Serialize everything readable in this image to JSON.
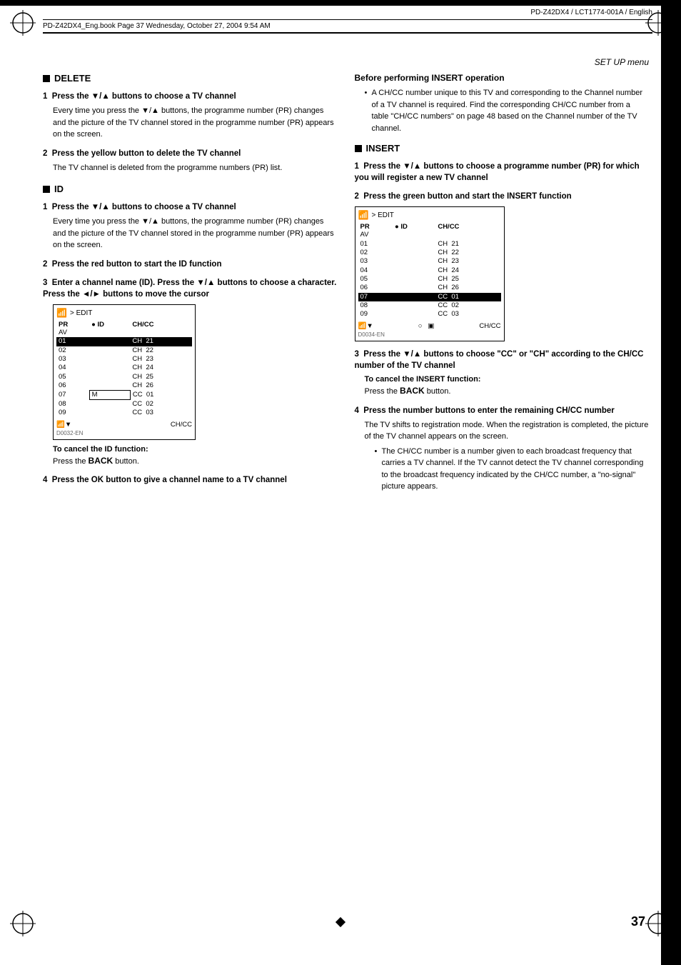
{
  "meta": {
    "product": "PD-Z42DX4 / LCT1774-001A / English",
    "book_line": "PD-Z42DX4_Eng.book  Page 37  Wednesday, October 27, 2004  9:54 AM",
    "page_title": "SET UP menu",
    "page_number": "37",
    "english_label": "ENGLISH"
  },
  "sections": {
    "delete": {
      "heading": "DELETE",
      "steps": [
        {
          "num": "1",
          "title": "Press the ▼/▲ buttons to choose a TV channel",
          "body": "Every time you press the ▼/▲ buttons, the programme number (PR) changes and the picture of the TV channel stored in the programme number (PR) appears on the screen."
        },
        {
          "num": "2",
          "title": "Press the yellow button to delete the TV channel",
          "body": "The TV channel is deleted from the programme numbers (PR) list."
        }
      ]
    },
    "id": {
      "heading": "ID",
      "steps": [
        {
          "num": "1",
          "title": "Press the ▼/▲ buttons to choose a TV channel",
          "body": "Every time you press the ▼/▲ buttons, the programme number (PR) changes and the picture of the TV channel stored in the programme number (PR) appears on the screen."
        },
        {
          "num": "2",
          "title": "Press the red button to start the ID function",
          "body": ""
        },
        {
          "num": "3",
          "title": "Enter a channel name (ID). Press the ▼/▲ buttons to choose a character. Press the ◄/► buttons to move the cursor",
          "body": ""
        }
      ],
      "cancel_note": "To cancel the ID function:",
      "cancel_body": "Press the BACK button.",
      "step4": {
        "num": "4",
        "title": "Press the OK button to give a channel name to a TV channel",
        "body": ""
      },
      "diagram_label": "D0032-EN",
      "diagram": {
        "header": "> EDIT",
        "columns": [
          "PR",
          "ID",
          "CH/CC"
        ],
        "rows": [
          [
            "AV",
            "",
            ""
          ],
          [
            "01",
            "",
            "CH  21"
          ],
          [
            "02",
            "",
            "CH  22"
          ],
          [
            "03",
            "",
            "CH  23"
          ],
          [
            "04",
            "",
            "CH  24"
          ],
          [
            "05",
            "",
            "CH  25"
          ],
          [
            "06",
            "",
            "CH  26"
          ],
          [
            "07",
            "M",
            "CC  01"
          ],
          [
            "08",
            "",
            "CC  02"
          ],
          [
            "09",
            "",
            "CC  03"
          ]
        ],
        "highlighted_row": 1
      }
    },
    "before_insert": {
      "heading": "Before performing INSERT operation",
      "body": "A CH/CC number unique to this TV and corresponding to the Channel number of a TV channel is required. Find the corresponding CH/CC number from a table \"CH/CC numbers\" on page 48 based on the Channel number of the TV channel."
    },
    "insert": {
      "heading": "INSERT",
      "steps": [
        {
          "num": "1",
          "title": "Press the ▼/▲ buttons to choose a programme number (PR) for which you will register a new TV channel",
          "body": ""
        },
        {
          "num": "2",
          "title": "Press the green button and start the INSERT function",
          "body": ""
        },
        {
          "num": "3",
          "title": "Press the ▼/▲ buttons to choose \"CC\" or \"CH\" according to the CH/CC number of the TV channel",
          "body": ""
        }
      ],
      "cancel_note": "To cancel the INSERT function:",
      "cancel_body": "Press the BACK button.",
      "step4": {
        "num": "4",
        "title": "Press the number buttons to enter the remaining CH/CC number",
        "body_intro": "The TV shifts to registration mode. When the registration is completed, the picture of the TV channel appears on the screen.",
        "bullets": [
          "The CH/CC number is a number given to each broadcast frequency that carries a TV channel. If the TV cannot detect the TV channel corresponding to the broadcast frequency indicated by the CH/CC number, a \"no-signal\" picture appears."
        ]
      },
      "diagram_label": "D0034-EN",
      "diagram": {
        "header": "> EDIT",
        "columns": [
          "PR",
          "ID",
          "CH/CC"
        ],
        "rows": [
          [
            "AV",
            "",
            ""
          ],
          [
            "01",
            "",
            "CH  21"
          ],
          [
            "02",
            "",
            "CH  22"
          ],
          [
            "03",
            "",
            "CH  23"
          ],
          [
            "04",
            "",
            "CH  24"
          ],
          [
            "05",
            "",
            "CH  25"
          ],
          [
            "06",
            "",
            "CH  26"
          ],
          [
            "07",
            "",
            "CC  01"
          ],
          [
            "08",
            "",
            "CC  02"
          ],
          [
            "09",
            "",
            "CC  03"
          ]
        ],
        "highlighted_row": 7
      }
    }
  }
}
